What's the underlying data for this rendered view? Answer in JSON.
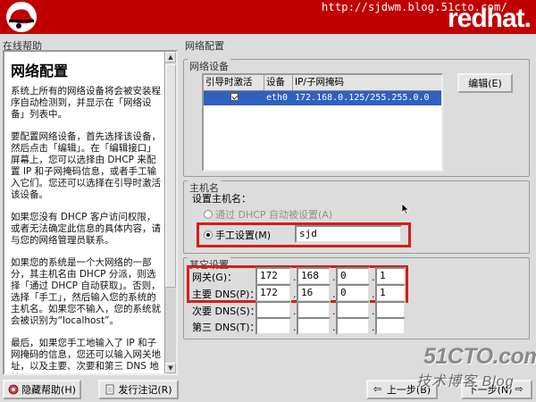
{
  "banner": {
    "url": "http://sjdwm.blog.51cto.com/",
    "brand": "redhat."
  },
  "help": {
    "header": "在线帮助",
    "title": "网络配置",
    "paragraphs": [
      "系统上所有的网络设备将会被安装程序自动检测到，并显示在「网络设备」列表中。",
      "要配置网络设备，首先选择该设备，然后点击「编辑」。在「编辑接口」屏幕上，您可以选择由 DHCP 来配置 IP 和子网掩码信息，或者手工输入它们。您还可以选择在引导时激活该设备。",
      "如果您没有 DHCP 客户访问权限，或者无法确定此信息的具体内容，请与您的网络管理员联系。",
      "如果您的系统是一个大网络的一部分，其主机名由 DHCP 分派，则选择「通过 DHCP 自动获取」。否则，选择「手工」，然后输入您的系统的主机名。如果您不输入，您的系统就会被识别为“localhost”。",
      "最后，如果您手工地输入了 IP 和子网掩码的信息，您还可以输入网关地址，以及主要、次要和第三 DNS 地址。"
    ]
  },
  "net": {
    "header": "网络配置",
    "devices_title": "网络设备",
    "columns": [
      "引导时激活",
      "设备",
      "IP/子网掩码"
    ],
    "device": {
      "name": "eth0",
      "ip_mask": "172.168.0.125/255.255.0.0"
    },
    "edit_button": "编辑(E)"
  },
  "hostname": {
    "title": "主机名",
    "prompt": "设置主机名：",
    "dhcp_option": "通过 DHCP 自动被设置(A)",
    "manual_option": "手工设置(M)",
    "value": "sjd"
  },
  "other": {
    "title": "其它设置",
    "gateway_label": "网关(G)：",
    "gateway": [
      "172",
      "168",
      "0",
      "1"
    ],
    "dns1_label": "主要 DNS(P)：",
    "dns1": [
      "172",
      "16",
      "0",
      "1"
    ],
    "dns2_label": "次要 DNS(S)：",
    "dns3_label": "第三 DNS(T)："
  },
  "footer": {
    "hide_help": "隐藏帮助(H)",
    "release_notes": "发行注记(R)",
    "back": "上一步(B)",
    "next": "下一步(N)"
  },
  "watermark": {
    "big": "51CTO.com",
    "small": "技术博客 Blog"
  },
  "colors": {
    "banner": "#c00000",
    "highlight": "#d51c1c",
    "selection": "#3060c0"
  }
}
